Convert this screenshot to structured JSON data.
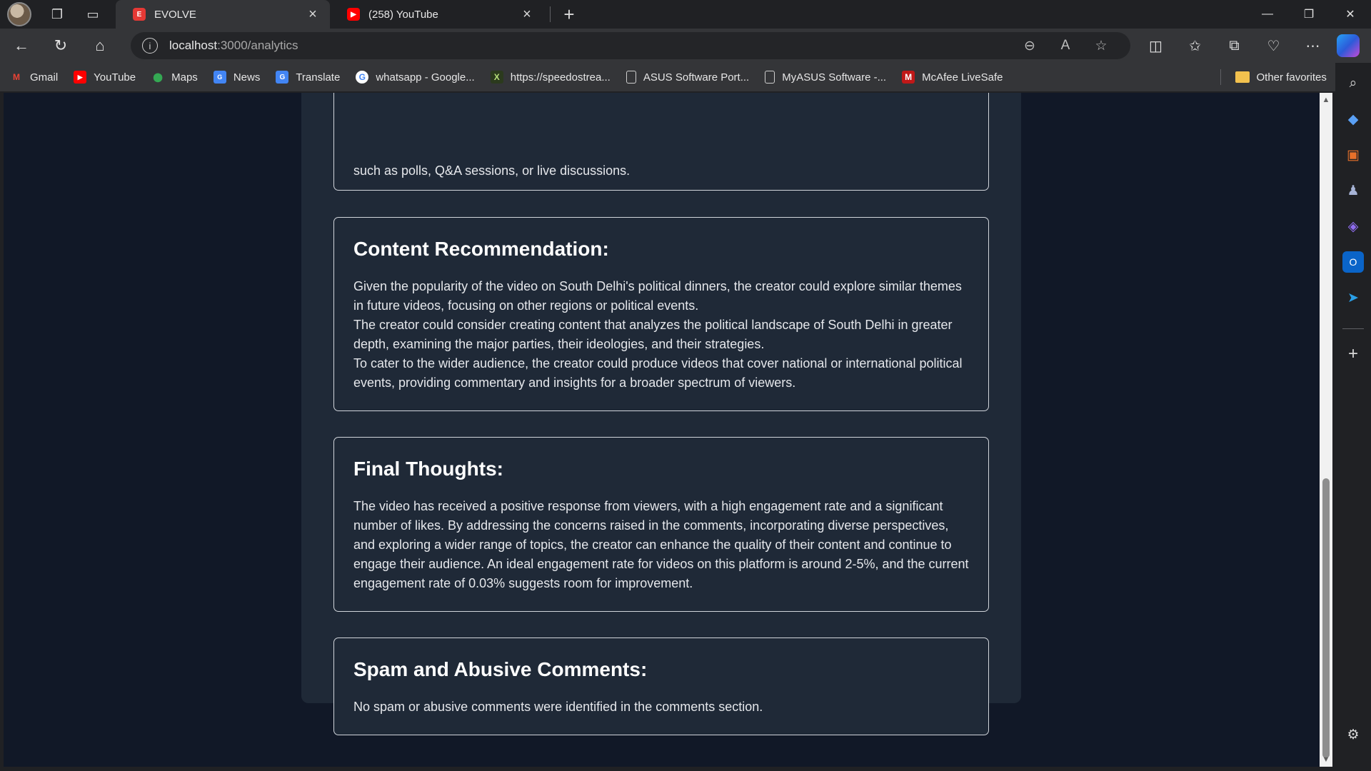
{
  "browser": {
    "tabs": [
      {
        "label": "EVOLVE",
        "favicon": "evolve-icon",
        "color": "#e53935"
      },
      {
        "label": "(258) YouTube",
        "favicon": "youtube-icon",
        "color": "#ff0000"
      }
    ],
    "url_host": "localhost",
    "url_path": ":3000/analytics",
    "favorites": [
      {
        "label": "Gmail",
        "icon": "gmail-icon"
      },
      {
        "label": "YouTube",
        "icon": "youtube-icon"
      },
      {
        "label": "Maps",
        "icon": "maps-icon"
      },
      {
        "label": "News",
        "icon": "news-icon"
      },
      {
        "label": "Translate",
        "icon": "translate-icon"
      },
      {
        "label": "whatsapp - Google...",
        "icon": "google-icon"
      },
      {
        "label": "https://speedostrea...",
        "icon": "excel-icon"
      },
      {
        "label": "ASUS Software Port...",
        "icon": "page-icon"
      },
      {
        "label": "MyASUS Software -...",
        "icon": "page-icon"
      },
      {
        "label": "McAfee LiveSafe",
        "icon": "mcafee-icon"
      }
    ],
    "other_favorites": "Other favorites"
  },
  "page": {
    "partial_text": "such as polls, Q&A sessions, or live discussions.",
    "sections": [
      {
        "title": "Content Recommendation:",
        "paragraphs": [
          "Given the popularity of the video on South Delhi's political dinners, the creator could explore similar themes in future videos, focusing on other regions or political events.",
          "The creator could consider creating content that analyzes the political landscape of South Delhi in greater depth, examining the major parties, their ideologies, and their strategies.",
          "To cater to the wider audience, the creator could produce videos that cover national or international political events, providing commentary and insights for a broader spectrum of viewers."
        ]
      },
      {
        "title": "Final Thoughts:",
        "paragraphs": [
          "The video has received a positive response from viewers, with a high engagement rate and a significant number of likes. By addressing the concerns raised in the comments, incorporating diverse perspectives, and exploring a wider range of topics, the creator can enhance the quality of their content and continue to engage their audience. An ideal engagement rate for videos on this platform is around 2-5%, and the current engagement rate of 0.03% suggests room for improvement."
        ]
      },
      {
        "title": "Spam and Abusive Comments:",
        "paragraphs": [
          "No spam or abusive comments were identified in the comments section."
        ]
      }
    ]
  }
}
